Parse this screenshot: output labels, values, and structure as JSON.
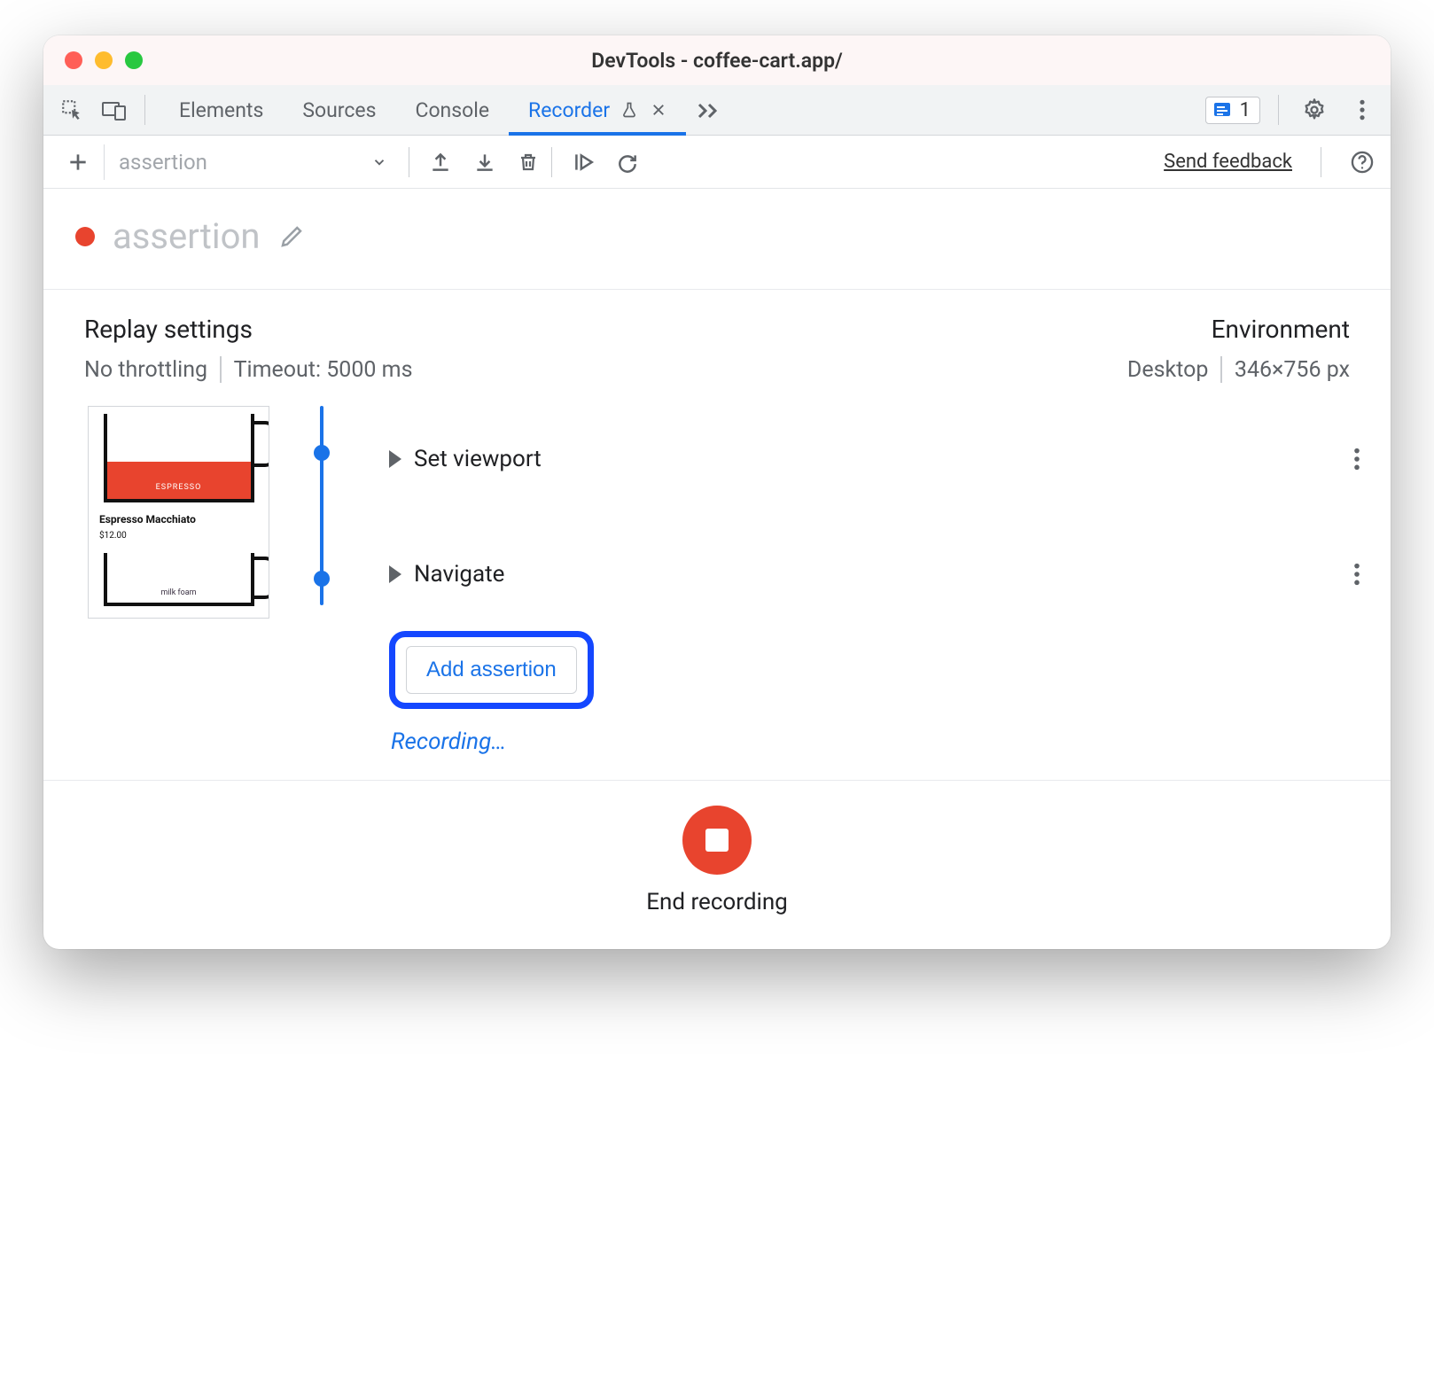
{
  "window": {
    "title": "DevTools - coffee-cart.app/"
  },
  "tabs": {
    "items": [
      "Elements",
      "Sources",
      "Console",
      "Recorder"
    ],
    "active": "Recorder"
  },
  "issues": {
    "count": "1"
  },
  "recorder_toolbar": {
    "selected_recording": "assertion",
    "send_feedback": "Send feedback"
  },
  "recording": {
    "name": "assertion",
    "status": "Recording…"
  },
  "replay_settings": {
    "heading": "Replay settings",
    "throttling": "No throttling",
    "timeout": "Timeout: 5000 ms"
  },
  "environment": {
    "heading": "Environment",
    "device": "Desktop",
    "viewport": "346×756 px"
  },
  "thumbnail": {
    "item_name": "Espresso Macchiato",
    "item_price": "$12.00",
    "cup1_label": "ESPRESSO",
    "cup2_label": "milk foam"
  },
  "steps": [
    {
      "label": "Set viewport"
    },
    {
      "label": "Navigate"
    }
  ],
  "add_assertion_label": "Add assertion",
  "footer": {
    "end_label": "End recording"
  }
}
